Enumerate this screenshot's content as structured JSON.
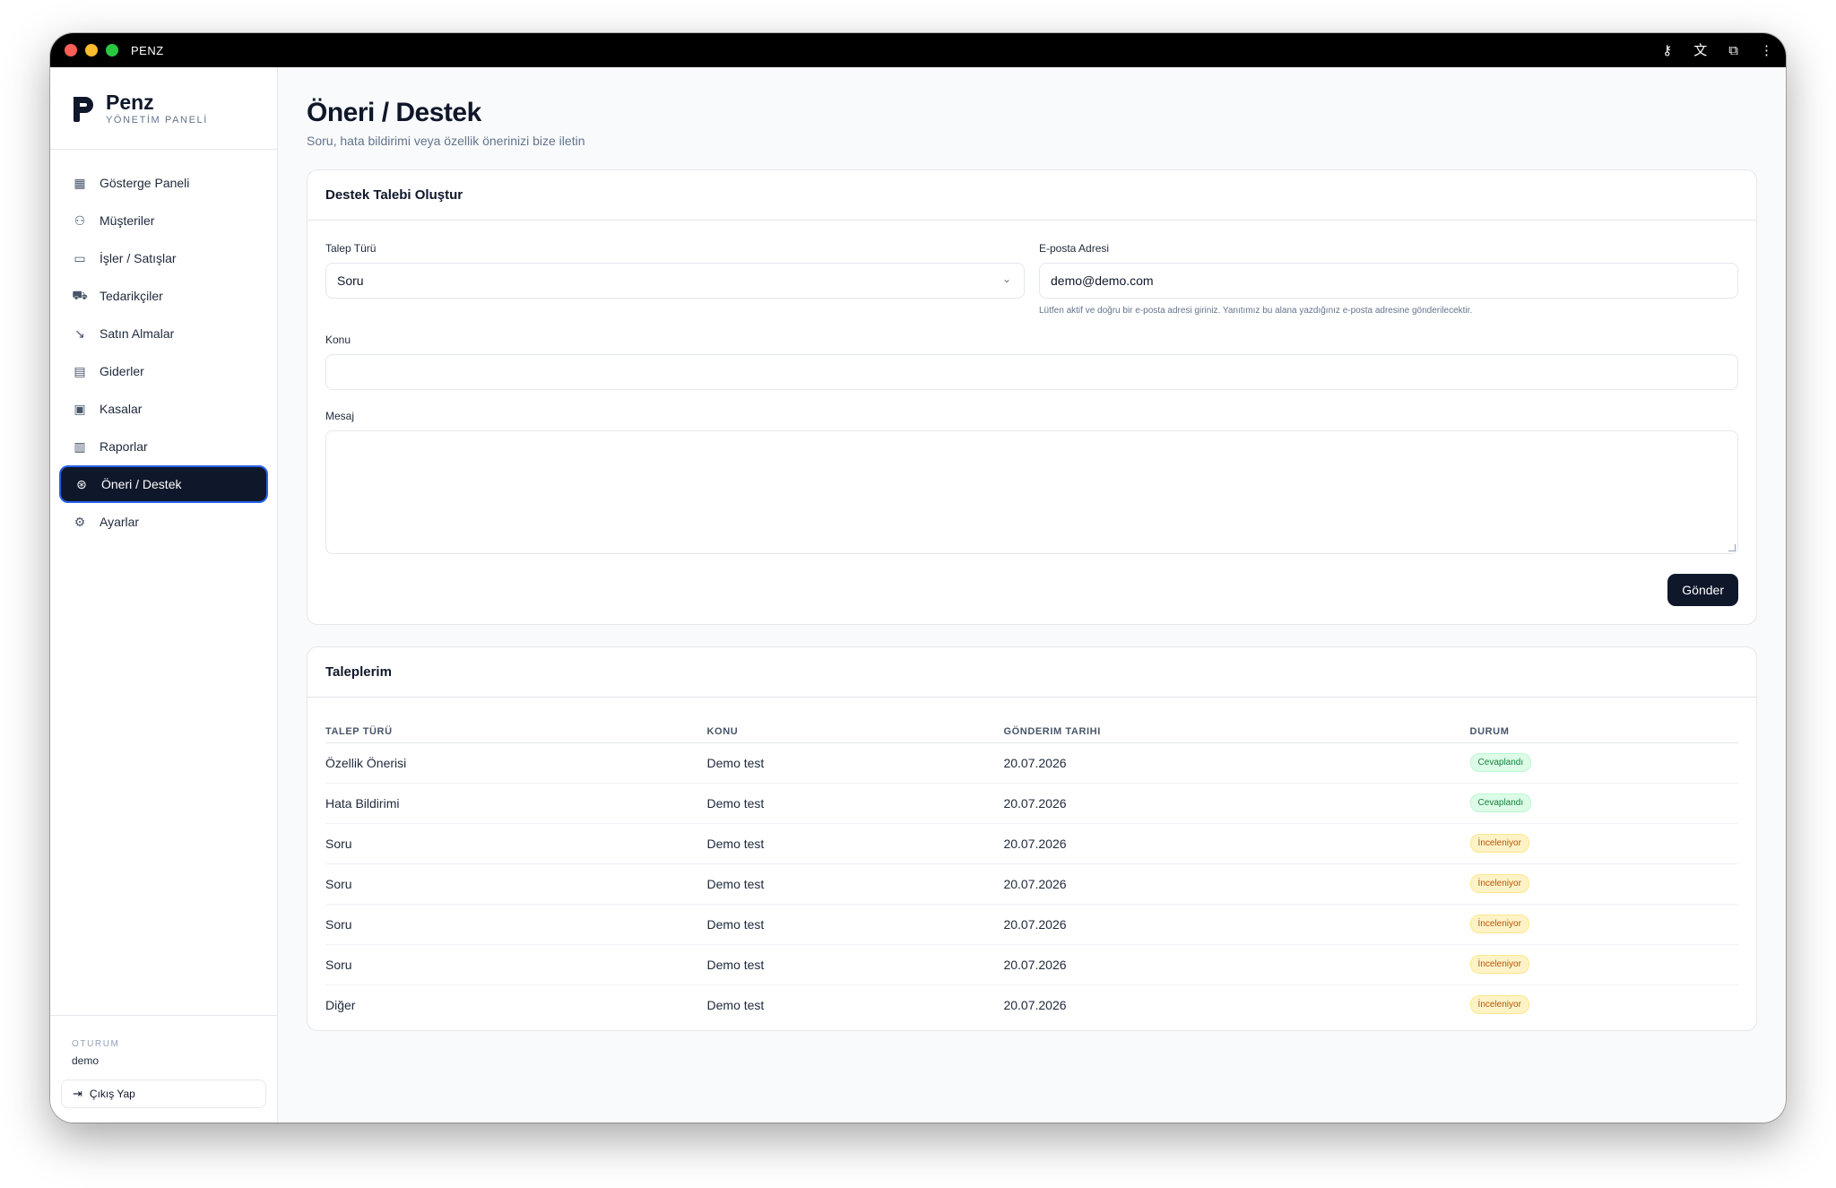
{
  "window": {
    "app_name": "PENZ",
    "title_icons": [
      "key-icon",
      "translate-icon",
      "extension-icon",
      "more-vertical-icon"
    ]
  },
  "brand": {
    "name": "Penz",
    "subtitle": "YÖNETİM PANELİ"
  },
  "sidebar": {
    "items": [
      {
        "label": "Gösterge Paneli",
        "icon": "dashboard-icon",
        "active": false
      },
      {
        "label": "Müşteriler",
        "icon": "users-icon",
        "active": false
      },
      {
        "label": "İşler / Satışlar",
        "icon": "folder-icon",
        "active": false
      },
      {
        "label": "Tedarikçiler",
        "icon": "truck-icon",
        "active": false
      },
      {
        "label": "Satın Almalar",
        "icon": "trend-down-icon",
        "active": false
      },
      {
        "label": "Giderler",
        "icon": "receipt-icon",
        "active": false
      },
      {
        "label": "Kasalar",
        "icon": "wallet-icon",
        "active": false
      },
      {
        "label": "Raporlar",
        "icon": "bar-chart-icon",
        "active": false
      },
      {
        "label": "Öneri / Destek",
        "icon": "lifebuoy-icon",
        "active": true
      },
      {
        "label": "Ayarlar",
        "icon": "gear-icon",
        "active": false
      }
    ],
    "session_label": "OTURUM",
    "session_user": "demo",
    "logout_label": "Çıkış Yap"
  },
  "page": {
    "title": "Öneri / Destek",
    "subtitle": "Soru, hata bildirimi veya özellik önerinizi bize iletin"
  },
  "form": {
    "card_title": "Destek Talebi Oluştur",
    "type_label": "Talep Türü",
    "type_value": "Soru",
    "email_label": "E-posta Adresi",
    "email_value": "demo@demo.com",
    "email_hint": "Lütfen aktif ve doğru bir e-posta adresi giriniz. Yanıtımız bu alana yazdığınız e-posta adresine gönderilecektir.",
    "subject_label": "Konu",
    "subject_value": "",
    "message_label": "Mesaj",
    "message_value": "",
    "submit_label": "Gönder"
  },
  "requests": {
    "card_title": "Taleplerim",
    "columns": [
      "TALEP TÜRÜ",
      "KONU",
      "GÖNDERIM TARIHI",
      "DURUM"
    ],
    "rows": [
      {
        "type": "Özellik Önerisi",
        "subject": "Demo test",
        "date": "20.07.2026",
        "status": "Cevaplandı",
        "tone": "green"
      },
      {
        "type": "Hata Bildirimi",
        "subject": "Demo test",
        "date": "20.07.2026",
        "status": "Cevaplandı",
        "tone": "green"
      },
      {
        "type": "Soru",
        "subject": "Demo test",
        "date": "20.07.2026",
        "status": "İnceleniyor",
        "tone": "amber"
      },
      {
        "type": "Soru",
        "subject": "Demo test",
        "date": "20.07.2026",
        "status": "İnceleniyor",
        "tone": "amber"
      },
      {
        "type": "Soru",
        "subject": "Demo test",
        "date": "20.07.2026",
        "status": "İnceleniyor",
        "tone": "amber"
      },
      {
        "type": "Soru",
        "subject": "Demo test",
        "date": "20.07.2026",
        "status": "İnceleniyor",
        "tone": "amber"
      },
      {
        "type": "Diğer",
        "subject": "Demo test",
        "date": "20.07.2026",
        "status": "İnceleniyor",
        "tone": "amber"
      }
    ]
  },
  "colors": {
    "primary": "#0f172a",
    "active_outline": "#2563eb",
    "badge_green": "#dcfce7",
    "badge_amber": "#fef3c7"
  }
}
